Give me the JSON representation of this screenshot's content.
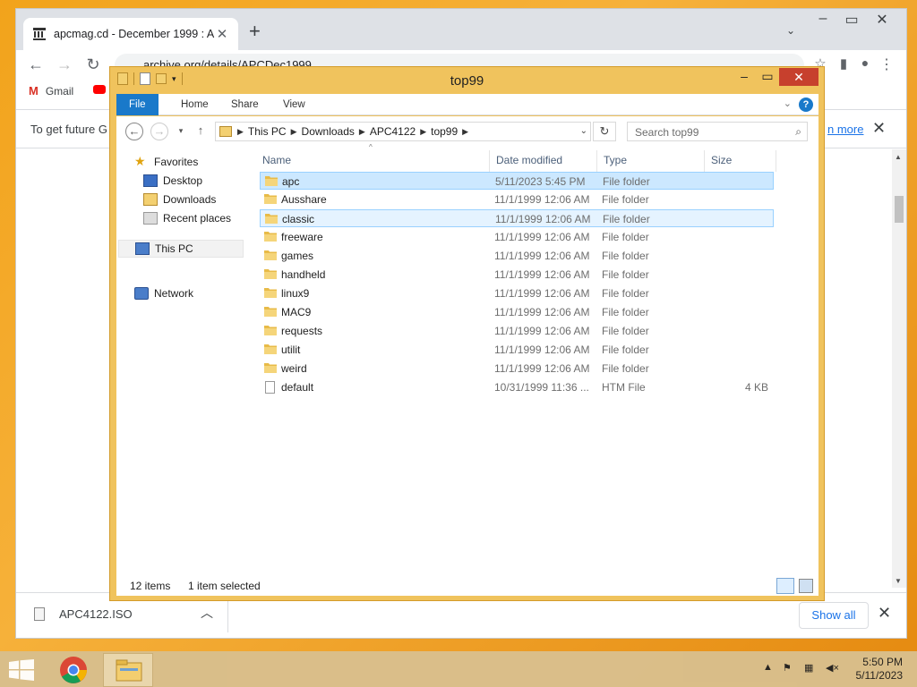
{
  "chrome": {
    "tab_title": "apcmag.cd - December 1999 : A",
    "url": "archive.org/details/APCDec1999",
    "bookmarks": [
      "Gmail"
    ],
    "infobar_message": "To get future G",
    "infobar_link": "n more",
    "download_file": "APC4122.ISO",
    "show_all": "Show all"
  },
  "explorer": {
    "title": "top99",
    "ribbon_tabs": [
      "File",
      "Home",
      "Share",
      "View"
    ],
    "breadcrumb": [
      "This PC",
      "Downloads",
      "APC4122",
      "top99"
    ],
    "search_placeholder": "Search top99",
    "nav": {
      "favorites": "Favorites",
      "desktop": "Desktop",
      "downloads": "Downloads",
      "recent": "Recent places",
      "thispc": "This PC",
      "network": "Network"
    },
    "columns": [
      "Name",
      "Date modified",
      "Type",
      "Size"
    ],
    "rows": [
      {
        "name": "apc",
        "date": "5/11/2023 5:45 PM",
        "type": "File folder",
        "size": "",
        "state": "selected"
      },
      {
        "name": "Ausshare",
        "date": "11/1/1999 12:06 AM",
        "type": "File folder",
        "size": ""
      },
      {
        "name": "classic",
        "date": "11/1/1999 12:06 AM",
        "type": "File folder",
        "size": "",
        "state": "hover"
      },
      {
        "name": "freeware",
        "date": "11/1/1999 12:06 AM",
        "type": "File folder",
        "size": ""
      },
      {
        "name": "games",
        "date": "11/1/1999 12:06 AM",
        "type": "File folder",
        "size": ""
      },
      {
        "name": "handheld",
        "date": "11/1/1999 12:06 AM",
        "type": "File folder",
        "size": ""
      },
      {
        "name": "linux9",
        "date": "11/1/1999 12:06 AM",
        "type": "File folder",
        "size": ""
      },
      {
        "name": "MAC9",
        "date": "11/1/1999 12:06 AM",
        "type": "File folder",
        "size": ""
      },
      {
        "name": "requests",
        "date": "11/1/1999 12:06 AM",
        "type": "File folder",
        "size": ""
      },
      {
        "name": "utilit",
        "date": "11/1/1999 12:06 AM",
        "type": "File folder",
        "size": ""
      },
      {
        "name": "weird",
        "date": "11/1/1999 12:06 AM",
        "type": "File folder",
        "size": ""
      },
      {
        "name": "default",
        "date": "10/31/1999 11:36 ...",
        "type": "HTM File",
        "size": "4 KB"
      }
    ],
    "status_items": "12 items",
    "status_selected": "1 item selected"
  },
  "taskbar": {
    "time": "5:50 PM",
    "date": "5/11/2023"
  },
  "colors": {
    "accent": "#1979ca",
    "explorer_frame": "#f0c35d",
    "selection": "#cce8ff"
  }
}
